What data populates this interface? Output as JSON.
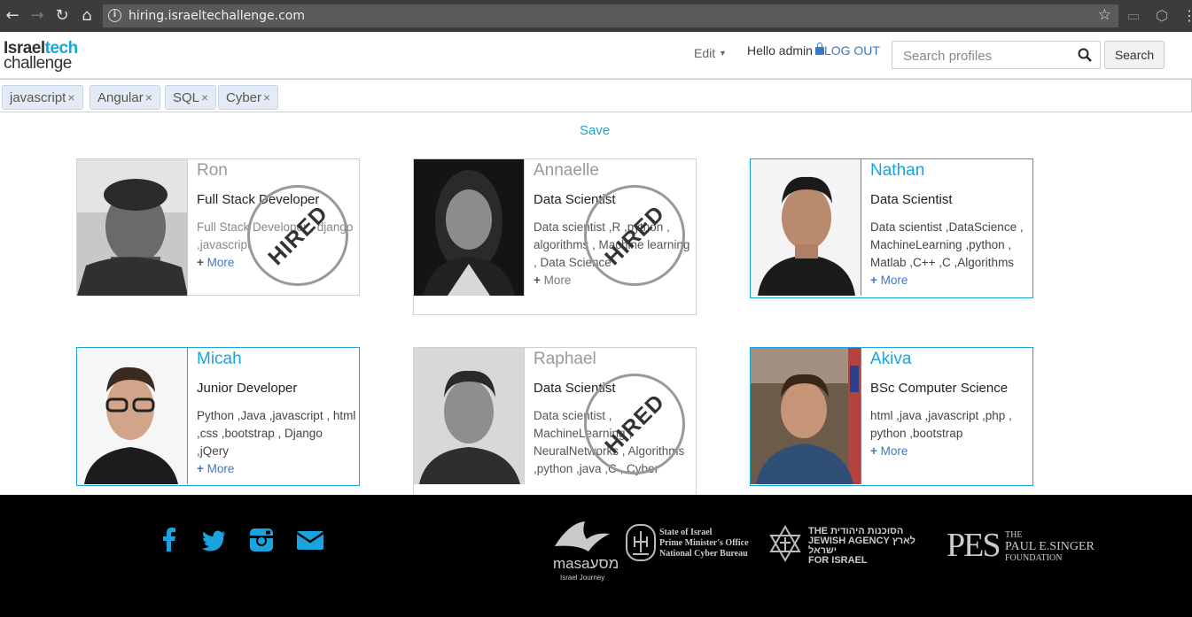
{
  "browser": {
    "url": "hiring.israeltechallenge.com"
  },
  "header": {
    "logo_line1_a": "Israel",
    "logo_line1_b": "tech",
    "logo_line2": "challenge",
    "edit_label": "Edit",
    "hello_text": "Hello admin",
    "logout_label": "LOG OUT",
    "search_placeholder": "Search profiles",
    "search_button": "Search"
  },
  "tags": [
    {
      "label": "javascript"
    },
    {
      "label": "Angular"
    },
    {
      "label": "SQL"
    },
    {
      "label": "Cyber"
    }
  ],
  "save_label": "Save",
  "hired_label": "HIRED",
  "more_label": "More",
  "profiles": [
    {
      "name": "Ron",
      "title": "Full Stack Developer",
      "skills": "Full Stack Developer , django ,javascript",
      "hired": true,
      "selected": false
    },
    {
      "name": "Annaelle",
      "title": "Data Scientist",
      "skills": "Data scientist ,R ,python , algorithms , Machine learning , Data Science",
      "hired": true,
      "selected": false
    },
    {
      "name": "Nathan",
      "title": "Data Scientist",
      "skills": "Data scientist ,DataScience , MachineLearning ,python , Matlab ,C++ ,C ,Algorithms",
      "hired": false,
      "selected": true
    },
    {
      "name": "Micah",
      "title": "Junior Developer",
      "skills": "Python ,Java ,javascript , html ,css ,bootstrap , Django ,jQery",
      "hired": false,
      "selected": true
    },
    {
      "name": "Raphael",
      "title": "Data Scientist",
      "skills": "Data scientist , MachineLearning , NeuralNetworks , Algorithms ,python ,java ,C , Cyber",
      "hired": true,
      "selected": false
    },
    {
      "name": "Akiva",
      "title": "BSc Computer Science",
      "skills": "html ,java ,javascript ,php , python ,bootstrap",
      "hired": false,
      "selected": true
    }
  ],
  "footer": {
    "social_icons": [
      "facebook-icon",
      "twitter-icon",
      "instagram-icon",
      "email-icon"
    ],
    "accent_color": "#1aa3dd",
    "sponsors": {
      "masa_name": "masa",
      "masa_hebrew": "מסע",
      "masa_sub": "Israel Journey",
      "pmo_line1": "State of Israel",
      "pmo_line2": "Prime Minister's Office",
      "pmo_line3": "National Cyber Bureau",
      "ja_hebrew1": "הסוכנות היהודית",
      "ja_hebrew2": "לארץ ישראל",
      "ja_line1": "THE",
      "ja_line2": "JEWISH AGENCY",
      "ja_line3": "FOR ISRAEL",
      "pes_mark": "PES",
      "pes_line1": "THE",
      "pes_line2": "PAUL E.SINGER",
      "pes_line3": "FOUNDATION"
    }
  }
}
